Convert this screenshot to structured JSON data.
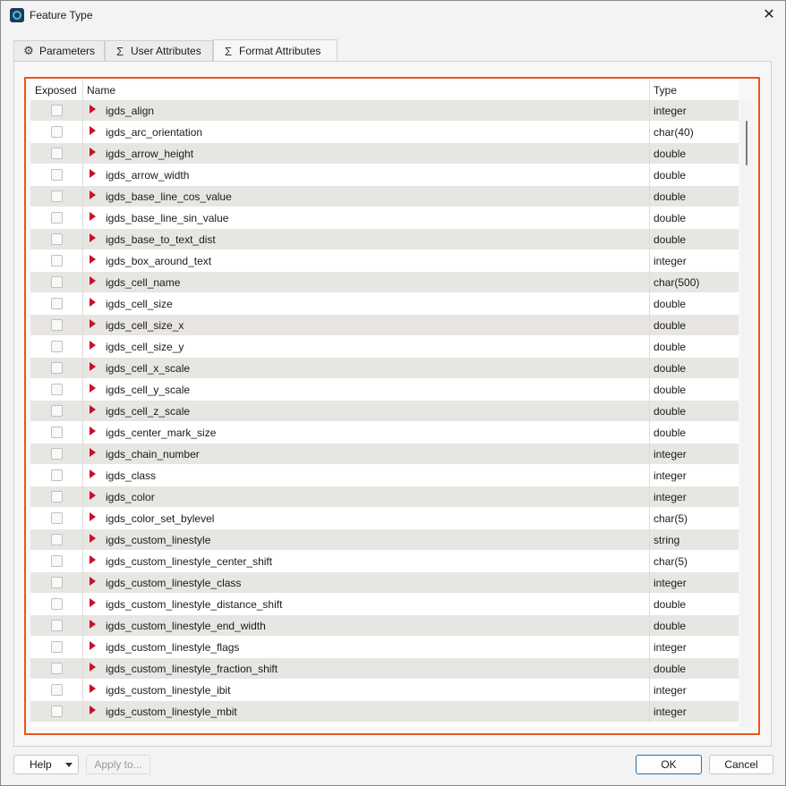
{
  "window": {
    "title": "Feature Type",
    "close_symbol": "✕"
  },
  "tabs": [
    {
      "label": "Parameters",
      "icon": "gear-icon"
    },
    {
      "label": "User Attributes",
      "icon": "sigma-icon"
    },
    {
      "label": "Format Attributes",
      "icon": "sigma-icon",
      "active": true
    }
  ],
  "table": {
    "columns": {
      "exposed": "Exposed",
      "name": "Name",
      "type": "Type"
    },
    "rows": [
      {
        "name": "igds_align",
        "type": "integer"
      },
      {
        "name": "igds_arc_orientation",
        "type": "char(40)"
      },
      {
        "name": "igds_arrow_height",
        "type": "double"
      },
      {
        "name": "igds_arrow_width",
        "type": "double"
      },
      {
        "name": "igds_base_line_cos_value",
        "type": "double"
      },
      {
        "name": "igds_base_line_sin_value",
        "type": "double"
      },
      {
        "name": "igds_base_to_text_dist",
        "type": "double"
      },
      {
        "name": "igds_box_around_text",
        "type": "integer"
      },
      {
        "name": "igds_cell_name",
        "type": "char(500)"
      },
      {
        "name": "igds_cell_size",
        "type": "double"
      },
      {
        "name": "igds_cell_size_x",
        "type": "double"
      },
      {
        "name": "igds_cell_size_y",
        "type": "double"
      },
      {
        "name": "igds_cell_x_scale",
        "type": "double"
      },
      {
        "name": "igds_cell_y_scale",
        "type": "double"
      },
      {
        "name": "igds_cell_z_scale",
        "type": "double"
      },
      {
        "name": "igds_center_mark_size",
        "type": "double"
      },
      {
        "name": "igds_chain_number",
        "type": "integer"
      },
      {
        "name": "igds_class",
        "type": "integer"
      },
      {
        "name": "igds_color",
        "type": "integer"
      },
      {
        "name": "igds_color_set_bylevel",
        "type": "char(5)"
      },
      {
        "name": "igds_custom_linestyle",
        "type": "string"
      },
      {
        "name": "igds_custom_linestyle_center_shift",
        "type": "char(5)"
      },
      {
        "name": "igds_custom_linestyle_class",
        "type": "integer"
      },
      {
        "name": "igds_custom_linestyle_distance_shift",
        "type": "double"
      },
      {
        "name": "igds_custom_linestyle_end_width",
        "type": "double"
      },
      {
        "name": "igds_custom_linestyle_flags",
        "type": "integer"
      },
      {
        "name": "igds_custom_linestyle_fraction_shift",
        "type": "double"
      },
      {
        "name": "igds_custom_linestyle_ibit",
        "type": "integer"
      },
      {
        "name": "igds_custom_linestyle_mbit",
        "type": "integer"
      }
    ]
  },
  "buttons": {
    "help": "Help",
    "apply_to": "Apply to...",
    "ok": "OK",
    "cancel": "Cancel"
  },
  "colors": {
    "highlight": "#e8571a",
    "triangle": "#c8102e",
    "row_alt": "#e8e6e2"
  }
}
